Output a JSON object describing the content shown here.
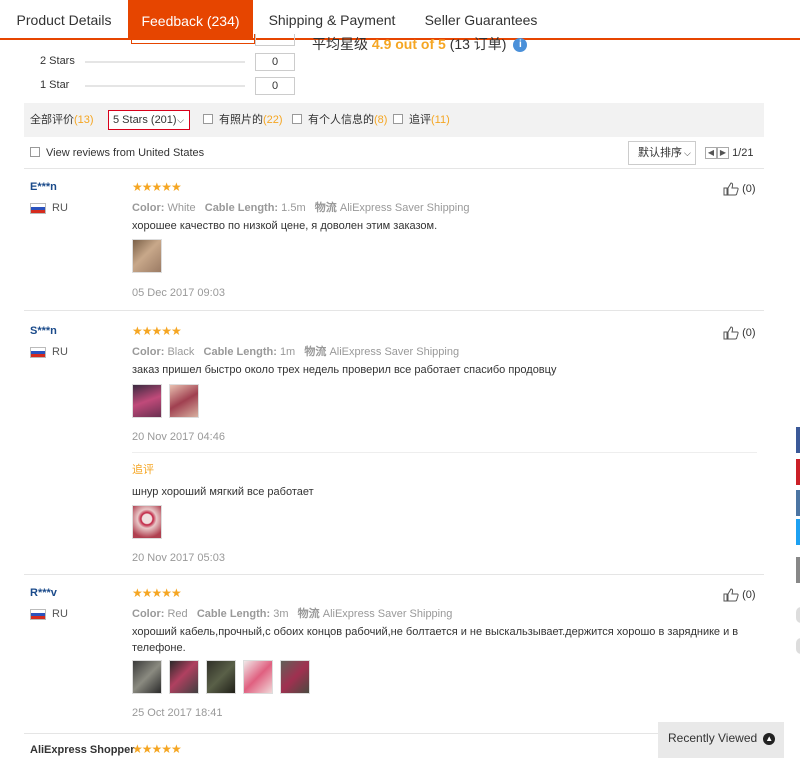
{
  "tabs": [
    {
      "label": "Product Details"
    },
    {
      "label": "Feedback (234)"
    },
    {
      "label": "Shipping & Payment"
    },
    {
      "label": "Seller Guarantees"
    }
  ],
  "distribution": [
    {
      "label": "2 Stars",
      "count": "0"
    },
    {
      "label": "1 Star",
      "count": "0"
    }
  ],
  "average": {
    "prefix": "平均星级",
    "score": "4.9 out of 5",
    "ratings": "(13 订单)",
    "info": "i"
  },
  "filters": {
    "all_label": "全部评价",
    "all_count": "(13)",
    "select_value": "5 Stars (201)",
    "photos_label": "有照片的",
    "photos_count": "(22)",
    "personal_label": "有个人信息的",
    "personal_count": "(8)",
    "additional_label": "追评",
    "additional_count": "(11)"
  },
  "us_filter": "View reviews from United States",
  "sort_label": "默认排序",
  "pager": "1/21",
  "reviews": [
    {
      "user": "E***n",
      "country": "RU",
      "stars": "★★★★★",
      "color_label": "Color:",
      "color": "White",
      "length_label": "Cable Length:",
      "length": "1.5m",
      "shipping_label": "物流",
      "shipping": "AliExpress Saver Shipping",
      "text": "хорошее качество по низкой цене, я доволен этим заказом.",
      "date": "05 Dec 2017 09:03",
      "likes": "(0)"
    },
    {
      "user": "S***n",
      "country": "RU",
      "stars": "★★★★★",
      "color_label": "Color:",
      "color": "Black",
      "length_label": "Cable Length:",
      "length": "1m",
      "shipping_label": "物流",
      "shipping": "AliExpress Saver Shipping",
      "text": "заказ пришел быстро около трех недель проверил все работает спасибо продовцу",
      "date": "20 Nov 2017 04:46",
      "likes": "(0)",
      "followup_label": "追评",
      "followup_text": "шнур хороший мягкий все работает",
      "followup_date": "20 Nov 2017 05:03"
    },
    {
      "user": "R***v",
      "country": "RU",
      "stars": "★★★★★",
      "color_label": "Color:",
      "color": "Red",
      "length_label": "Cable Length:",
      "length": "3m",
      "shipping_label": "物流",
      "shipping": "AliExpress Saver Shipping",
      "text": "хороший кабель,прочный,с обоих концов рабочий,не болтается и не выскальзывает.держится хорошо в зарядникe и в телефоне.",
      "date": "25 Oct 2017 18:41",
      "likes": "(0)"
    }
  ],
  "partial_user": "AliExpress Shopper",
  "partial_stars": "★★★★★",
  "recently_viewed": "Recently Viewed",
  "colors": {
    "accent": "#e64500",
    "star": "#f5a623",
    "link": "#1a4a8a"
  }
}
